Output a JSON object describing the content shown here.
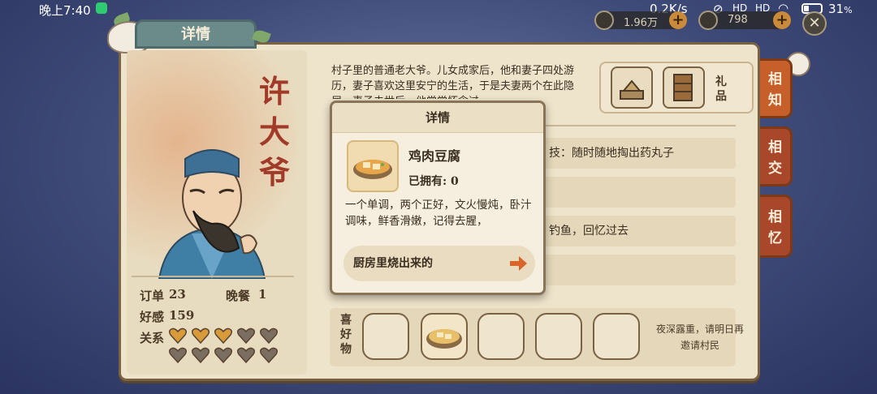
{
  "status_bar": {
    "time": "晚上7:40",
    "net_speed": "0.2K/s",
    "signal_1": "HD",
    "signal_2": "HD",
    "battery": "31",
    "battery_level": 0.31
  },
  "currency": {
    "coins": "1.96万",
    "gems": "798"
  },
  "header": {
    "title": "详情"
  },
  "character": {
    "name": "许大爷",
    "stats": {
      "orders_label": "订单",
      "orders_value": "23",
      "dinner_label": "晚餐",
      "dinner_value": "1",
      "affection_label": "好感",
      "affection_value": "159",
      "relation_label": "关系"
    },
    "relation_level": {
      "filled": 3,
      "total": 10
    }
  },
  "info": {
    "description": "村子里的普通老大爷。儿女成家后，他和妻子四处游历，妻子喜欢这里安宁的生活，于是夫妻两个在此隐居。妻子去世后，他常常怀念过",
    "gifts_label": "礼品",
    "rows": [
      "技：随时随地掏出药丸子",
      "",
      "钓鱼，回忆过去",
      ""
    ]
  },
  "side_tabs": [
    "相知",
    "相交",
    "相忆"
  ],
  "favorites": {
    "label": "喜好物",
    "note": "夜深露重，请明日再邀请村民"
  },
  "popup": {
    "title": "详情",
    "item_name": "鸡肉豆腐",
    "owned_label": "已拥有:",
    "owned_value": "0",
    "description": "一个单调，两个正好，文火慢炖，卧汁调味，鲜香滑嫩，记得去腥，",
    "source": "厨房里烧出来的"
  },
  "colors": {
    "panel": "#eee3cb",
    "accent": "#c75f2a",
    "tab": "#c25a24",
    "name": "#a13a28",
    "heart_filled": "#d99a3a",
    "heart_empty": "#7a6e60"
  }
}
